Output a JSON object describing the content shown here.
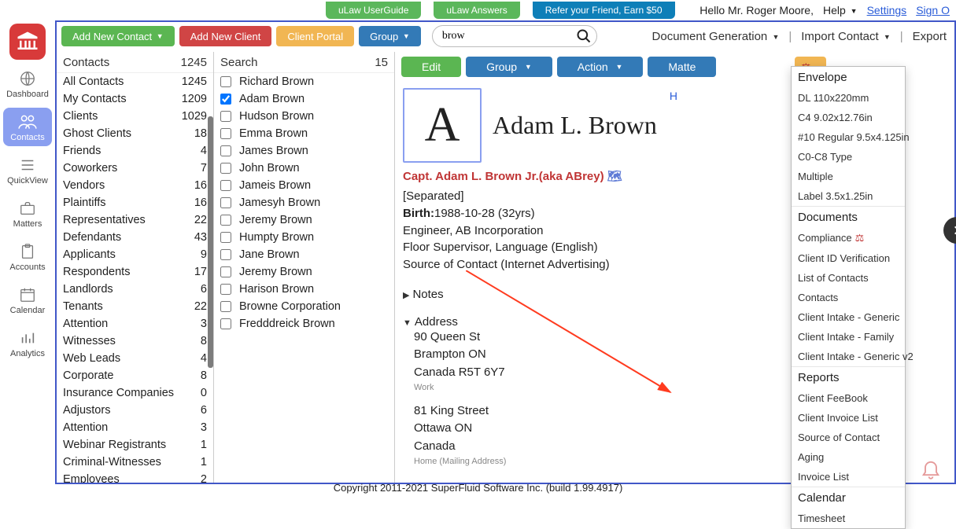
{
  "top": {
    "userguide": "uLaw UserGuide",
    "answers": "uLaw Answers",
    "refer": "Refer your Friend, Earn $50",
    "greeting": "Hello Mr. Roger Moore,",
    "help": "Help",
    "settings": "Settings",
    "signout": "Sign O"
  },
  "toolbar": {
    "addcontact": "Add New Contact",
    "addclient": "Add New Client",
    "clientportal": "Client Portal",
    "group": "Group",
    "searchval": "brow",
    "docgen": "Document Generation",
    "importcontact": "Import Contact",
    "export": "Export"
  },
  "nav": {
    "dashboard": "Dashboard",
    "contacts": "Contacts",
    "quickview": "QuickView",
    "matters": "Matters",
    "accounts": "Accounts",
    "calendar": "Calendar",
    "analytics": "Analytics"
  },
  "col1": {
    "header": "Contacts",
    "headcount": "1245",
    "rows": [
      {
        "l": "All Contacts",
        "n": "1245"
      },
      {
        "l": "My Contacts",
        "n": "1209"
      },
      {
        "l": "Clients",
        "n": "1029"
      },
      {
        "l": "Ghost Clients",
        "n": "18"
      },
      {
        "l": "Friends",
        "n": "4"
      },
      {
        "l": "Coworkers",
        "n": "7"
      },
      {
        "l": "Vendors",
        "n": "16"
      },
      {
        "l": "Plaintiffs",
        "n": "16"
      },
      {
        "l": "Representatives",
        "n": "22"
      },
      {
        "l": "Defendants",
        "n": "43"
      },
      {
        "l": "Applicants",
        "n": "9"
      },
      {
        "l": "Respondents",
        "n": "17"
      },
      {
        "l": "Landlords",
        "n": "6"
      },
      {
        "l": "Tenants",
        "n": "22"
      },
      {
        "l": "Attention",
        "n": "3"
      },
      {
        "l": "Witnesses",
        "n": "8"
      },
      {
        "l": "Web Leads",
        "n": "4"
      },
      {
        "l": "Corporate",
        "n": "8"
      },
      {
        "l": "Insurance Companies",
        "n": "0"
      },
      {
        "l": "Adjustors",
        "n": "6"
      },
      {
        "l": "Attention",
        "n": "3"
      },
      {
        "l": "Webinar Registrants",
        "n": "1"
      },
      {
        "l": "Criminal-Witnesses",
        "n": "1"
      },
      {
        "l": "Employees",
        "n": "2"
      }
    ]
  },
  "col2": {
    "header": "Search",
    "headcount": "15",
    "rows": [
      {
        "l": "Richard Brown",
        "c": false
      },
      {
        "l": "Adam Brown",
        "c": true
      },
      {
        "l": "Hudson Brown",
        "c": false
      },
      {
        "l": "Emma Brown",
        "c": false
      },
      {
        "l": "James Brown",
        "c": false
      },
      {
        "l": "John Brown",
        "c": false
      },
      {
        "l": "Jameis Brown",
        "c": false
      },
      {
        "l": "Jamesyh Brown",
        "c": false
      },
      {
        "l": "Jeremy Brown",
        "c": false
      },
      {
        "l": "Humpty Brown",
        "c": false
      },
      {
        "l": "Jane Brown",
        "c": false
      },
      {
        "l": "Jeremy Brown",
        "c": false
      },
      {
        "l": "Harison Brown",
        "c": false
      },
      {
        "l": "Browne Corporation",
        "c": false
      },
      {
        "l": "Fredddreick Brown",
        "c": false
      }
    ]
  },
  "actionbar": {
    "edit": "Edit",
    "group": "Group",
    "action": "Action",
    "matter": "Matte"
  },
  "contact": {
    "initial": "A",
    "name": "Adam L. Brown",
    "fullname": "Capt. Adam L. Brown Jr.(aka ABrey)",
    "Hletter": "H",
    "status": "[Separated]",
    "birthlbl": "Birth:",
    "birthval": "1988-10-28 (32yrs)",
    "job": "Engineer, AB Incorporation",
    "role": "Floor Supervisor, Language (English)",
    "source": "Source of Contact (Internet Advertising)",
    "notes": "Notes",
    "address": "Address",
    "addr1_l1": "90 Queen St",
    "addr1_l2": "Brampton ON",
    "addr1_l3": "Canada   R5T 6Y7",
    "addr1_lbl": "Work",
    "addr2_l1": "81 King Street",
    "addr2_l2": "Ottawa    ON",
    "addr2_l3": "Canada",
    "addr2_lbl": "Home (Mailing Address)"
  },
  "dropdown": {
    "envelope": "Envelope",
    "env": [
      "DL 110x220mm",
      "C4 9.02x12.76in",
      "#10 Regular 9.5x4.125in",
      "C0-C8 Type",
      "Multiple",
      "Label 3.5x1.25in"
    ],
    "documents": "Documents",
    "doc": [
      "Compliance",
      "Client ID Verification",
      "List of Contacts",
      "Contacts",
      "Client Intake - Generic",
      "Client Intake - Family",
      "Client Intake - Generic v2"
    ],
    "reports": "Reports",
    "rep": [
      "Client FeeBook",
      "Client Invoice List",
      "Source of Contact",
      "Aging",
      "Invoice List"
    ],
    "calendar": "Calendar",
    "cal": [
      "Timesheet"
    ]
  },
  "footer": "Copyright 2011-2021 SuperFluid Software Inc. (build 1.99.4917)"
}
